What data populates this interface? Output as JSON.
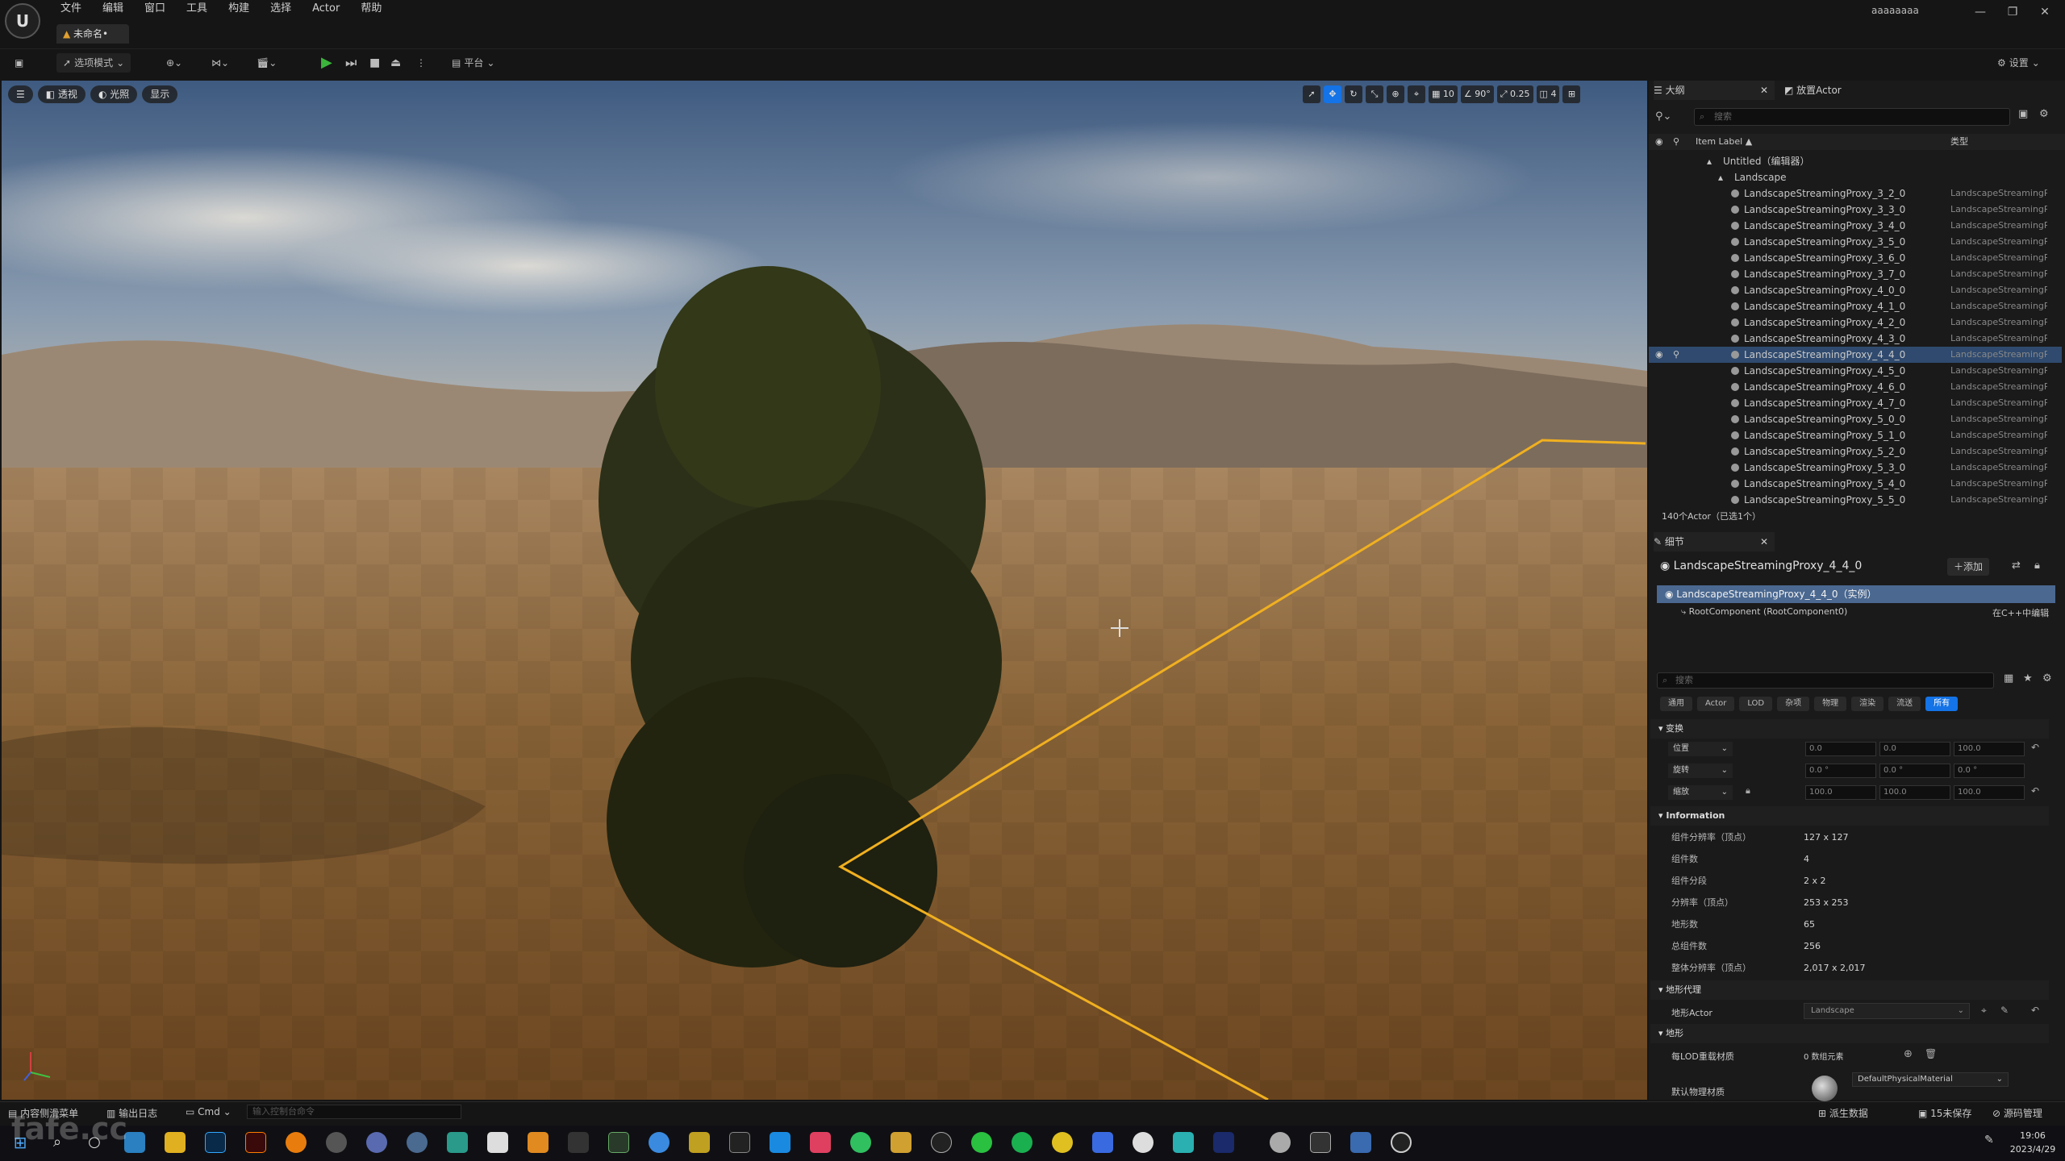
{
  "app": {
    "menu": [
      "文件",
      "编辑",
      "窗口",
      "工具",
      "构建",
      "选择",
      "Actor",
      "帮助"
    ],
    "user": "aaaaaaaa",
    "level_tab": "未命名•"
  },
  "toolbar": {
    "mode": "选项模式",
    "platform": "平台",
    "settings": "设置"
  },
  "viewport": {
    "perspective": "透视",
    "lit": "光照",
    "show": "显示",
    "grid_value": "10",
    "angle_value": "90°",
    "scale_value": "0.25",
    "camera_value": "4"
  },
  "outliner": {
    "tab": "大纲",
    "tab2": "放置Actor",
    "search_placeholder": "搜索",
    "col_label": "Item Label ▲",
    "col_type": "类型",
    "root": "Untitled（编辑器）",
    "landscape": "Landscape",
    "type_text": "LandscapeStreamingProxy",
    "items": [
      "LandscapeStreamingProxy_3_2_0",
      "LandscapeStreamingProxy_3_3_0",
      "LandscapeStreamingProxy_3_4_0",
      "LandscapeStreamingProxy_3_5_0",
      "LandscapeStreamingProxy_3_6_0",
      "LandscapeStreamingProxy_3_7_0",
      "LandscapeStreamingProxy_4_0_0",
      "LandscapeStreamingProxy_4_1_0",
      "LandscapeStreamingProxy_4_2_0",
      "LandscapeStreamingProxy_4_3_0",
      "LandscapeStreamingProxy_4_4_0",
      "LandscapeStreamingProxy_4_5_0",
      "LandscapeStreamingProxy_4_6_0",
      "LandscapeStreamingProxy_4_7_0",
      "LandscapeStreamingProxy_5_0_0",
      "LandscapeStreamingProxy_5_1_0",
      "LandscapeStreamingProxy_5_2_0",
      "LandscapeStreamingProxy_5_3_0",
      "LandscapeStreamingProxy_5_4_0",
      "LandscapeStreamingProxy_5_5_0"
    ],
    "status": "140个Actor（已选1个）"
  },
  "details": {
    "tab": "细节",
    "actor_name": "LandscapeStreamingProxy_4_4_0",
    "add_button": "添加",
    "instance_label": "LandscapeStreamingProxy_4_4_0（实例）",
    "root_component": "RootComponent (RootComponent0)",
    "edit_cpp": "在C++中编辑",
    "search_placeholder": "搜索",
    "categories": [
      "通用",
      "Actor",
      "LOD",
      "杂项",
      "物理",
      "渲染",
      "流送",
      "所有"
    ],
    "transform_section": "变换",
    "location_label": "位置",
    "rotation_label": "旋转",
    "scale_label": "缩放",
    "location": [
      "0.0",
      "0.0",
      "100.0"
    ],
    "rotation": [
      "0.0 °",
      "0.0 °",
      "0.0 °"
    ],
    "scale": [
      "100.0",
      "100.0",
      "100.0"
    ],
    "info_section": "Information",
    "info": [
      {
        "k": "组件分辨率（顶点）",
        "v": "127 x 127"
      },
      {
        "k": "组件数",
        "v": "4"
      },
      {
        "k": "组件分段",
        "v": "2 x 2"
      },
      {
        "k": "分辨率（顶点）",
        "v": "253 x 253"
      },
      {
        "k": "地形数",
        "v": "65"
      },
      {
        "k": "总组件数",
        "v": "256"
      },
      {
        "k": "整体分辨率（顶点）",
        "v": "2,017 x 2,017"
      }
    ],
    "proxy_section": "地形代理",
    "landscape_actor_label": "地形Actor",
    "landscape_actor_value": "Landscape",
    "landscape_section": "地形",
    "lod_material_label": "每LOD重载材质",
    "lod_material_value": "0 数组元素",
    "phys_material_label": "默认物理材质",
    "phys_material_value": "DefaultPhysicalMaterial"
  },
  "bottombar": {
    "content_drawer": "内容侧滑菜单",
    "output_log": "输出日志",
    "cmd": "Cmd",
    "console_placeholder": "输入控制台命令",
    "derived_data": "派生数据",
    "unsaved": "15未保存",
    "source_control": "源码管理"
  },
  "taskbar": {
    "time": "19:06",
    "date": "2023/4/29"
  },
  "watermark": "fafe.cc",
  "colors": {
    "selection": "#2f4a6e",
    "accent_blue": "#1473e6",
    "outline_yellow": "#f0b020",
    "play_green": "#3cb43c"
  }
}
